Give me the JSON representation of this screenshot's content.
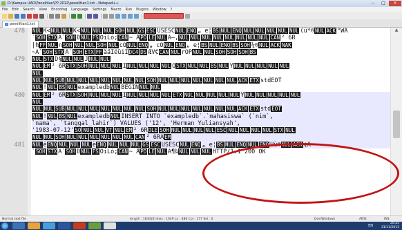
{
  "window": {
    "title": "D:\\Kampus UAD\\Penelitian\\PP 2012\\penelitian1.txt - Notepad++",
    "minimize": "‒",
    "maximize": "□",
    "close": "✕"
  },
  "menu": [
    "File",
    "Edit",
    "Search",
    "View",
    "Encoding",
    "Language",
    "Settings",
    "Macro",
    "Run",
    "Plugins",
    "Window",
    "?"
  ],
  "tab": {
    "label": "penelitian1.txt"
  },
  "editor": {
    "lines": [
      {
        "num": "478",
        "segments": [
          {
            "c": "NUL"
          },
          {
            "t": "K<"
          },
          {
            "c": "NUL"
          },
          {
            "c": "NUL"
          },
          {
            "t": "K<"
          },
          {
            "c": "NUL"
          },
          {
            "c": "NUL"
          },
          {
            "c": "NUL"
          },
          {
            "c": "SOH"
          },
          {
            "c": "NUL"
          },
          {
            "c": "GS"
          },
          {
            "c": "ESC"
          },
          {
            "t": "USESC"
          },
          {
            "c": "NUL"
          },
          {
            "c": "ENQ"
          },
          {
            "t": "„ e¦"
          },
          {
            "c": "BS"
          },
          {
            "c": "NUL"
          },
          {
            "c": "ENQ"
          },
          {
            "c": "NUL"
          },
          {
            "c": "NUL"
          },
          {
            "c": "NUL"
          },
          {
            "c": "NUL"
          },
          {
            "c": "NUL"
          },
          {
            "t": "(ü*®"
          },
          {
            "c": "NUL"
          },
          {
            "c": "ACK"
          },
          {
            "t": "°WA"
          }
        ]
      },
      {
        "num": "",
        "segments": [
          {
            "t": "`"
          },
          {
            "c": "SOH"
          },
          {
            "c": "STX"
          },
          {
            "t": "Ã`"
          },
          {
            "c": "SOH"
          },
          {
            "t": "Ð"
          },
          {
            "c": "NUL"
          },
          {
            "c": "FS"
          },
          {
            "t": "ÒiLó;"
          },
          {
            "c": "CAN"
          },
          {
            "t": "~ Å"
          },
          {
            "c": "PD"
          },
          {
            "c": "LE"
          },
          {
            "c": "NUL"
          },
          {
            "t": "A–,"
          },
          {
            "c": "NUL"
          },
          {
            "c": "NUL"
          },
          {
            "c": "NUL"
          },
          {
            "c": "NUL"
          },
          {
            "c": "NUL"
          },
          {
            "c": "NUL"
          },
          {
            "c": "NUL"
          },
          {
            "c": "NUL"
          },
          {
            "c": "CAN"
          },
          {
            "t": "² 6R"
          }
        ]
      },
      {
        "num": "",
        "segments": [
          {
            "t": "|h"
          },
          {
            "c": "FF"
          },
          {
            "c": "NUL"
          },
          {
            "t": "n"
          },
          {
            "c": "SOH"
          },
          {
            "c": "NUL"
          },
          {
            "c": "NUL"
          },
          {
            "c": "SOH"
          },
          {
            "c": "NUL"
          },
          {
            "t": "cÖ"
          },
          {
            "c": "NUL"
          },
          {
            "c": "ENQ"
          },
          {
            "t": "„ cÖ"
          },
          {
            "c": "NUL"
          },
          {
            "c": "ENQ"
          },
          {
            "t": "„ e¦"
          },
          {
            "c": "BS"
          },
          {
            "c": "NUL"
          },
          {
            "c": "ENQ"
          },
          {
            "c": "BS"
          },
          {
            "c": "SOH"
          },
          {
            "t": "¼®"
          },
          {
            "c": "NUL"
          },
          {
            "c": "ACK"
          },
          {
            "c": "NAK"
          }
        ]
      },
      {
        "num": "",
        "segments": [
          {
            "t": "~A`"
          },
          {
            "c": "SOH"
          },
          {
            "c": "STX"
          },
          {
            "t": "Ã`"
          },
          {
            "c": "SOH"
          },
          {
            "c": "ETX"
          },
          {
            "c": "FF"
          },
          {
            "t": "åäIéüiI"
          },
          {
            "c": "DC4"
          },
          {
            "c": "DS"
          },
          {
            "t": "ÆV€"
          },
          {
            "c": "CAN"
          },
          {
            "c": "NUL"
          },
          {
            "t": "rÓP"
          },
          {
            "c": "NUL"
          },
          {
            "c": "NUL"
          },
          {
            "c": "SOH"
          },
          {
            "c": "SOH"
          },
          {
            "c": "SOH"
          },
          {
            "c": "BS"
          }
        ]
      },
      {
        "num": "479",
        "segments": [
          {
            "c": "NUL"
          },
          {
            "c": "STX"
          },
          {
            "t": "D§"
          },
          {
            "c": "NUL"
          },
          {
            "c": "NUL"
          },
          {
            "t": "J"
          },
          {
            "c": "NUL"
          },
          {
            "c": "NUL"
          }
        ]
      },
      {
        "num": "",
        "segments": [
          {
            "c": "NUL"
          },
          {
            "c": "EM"
          },
          {
            "t": "² 6R"
          },
          {
            "c": "STX"
          },
          {
            "c": "SOH"
          },
          {
            "c": "NUL"
          },
          {
            "c": "NUL"
          },
          {
            "c": "NUL"
          },
          {
            "t": "I"
          },
          {
            "c": "NUL"
          },
          {
            "c": "NUL"
          },
          {
            "c": "NUL"
          },
          {
            "c": "NUL"
          },
          {
            "t": "Ò"
          },
          {
            "c": "STX"
          },
          {
            "c": "NUL"
          },
          {
            "c": "NUL"
          },
          {
            "c": "BS"
          },
          {
            "c": "NUL"
          },
          {
            "t": "Y"
          },
          {
            "c": "NUL"
          },
          {
            "c": "NUL"
          },
          {
            "c": "NUL"
          },
          {
            "c": "NUL"
          },
          {
            "c": "NUL"
          }
        ]
      },
      {
        "num": "",
        "segments": [
          {
            "c": "NUL"
          }
        ]
      },
      {
        "num": "",
        "segments": [
          {
            "c": "NUL"
          },
          {
            "c": "NUL"
          },
          {
            "c": "SUB"
          },
          {
            "c": "NUL"
          },
          {
            "c": "NUL"
          },
          {
            "c": "NUL"
          },
          {
            "c": "NUL"
          },
          {
            "c": "NUL"
          },
          {
            "c": "NUL"
          },
          {
            "c": "NUL"
          },
          {
            "c": "SOH"
          },
          {
            "c": "NUL"
          },
          {
            "c": "NUL"
          },
          {
            "c": "NUL"
          },
          {
            "c": "NUL"
          },
          {
            "c": "NUL"
          },
          {
            "c": "NUL"
          },
          {
            "c": "NUL"
          },
          {
            "c": "ACK"
          },
          {
            "c": "ETX"
          },
          {
            "t": "stdEOT"
          }
        ]
      },
      {
        "num": "",
        "segments": [
          {
            "c": "NUL"
          },
          {
            "t": "!"
          },
          {
            "c": "NUL"
          },
          {
            "c": "BS"
          },
          {
            "c": "NUL"
          },
          {
            "t": "exampledb"
          },
          {
            "c": "NUL"
          },
          {
            "t": "BEGIN"
          },
          {
            "c": "NUL"
          },
          {
            "c": "NUL"
          }
        ]
      },
      {
        "num": "480",
        "segments": [
          {
            "c": "NUL"
          },
          {
            "c": "EM"
          },
          {
            "t": "² 6R"
          },
          {
            "c": "STX"
          },
          {
            "c": "SOH"
          },
          {
            "c": "NUL"
          },
          {
            "c": "NUL"
          },
          {
            "c": "NUL"
          },
          {
            "t": "I"
          },
          {
            "c": "NUL"
          },
          {
            "c": "NUL"
          },
          {
            "c": "NUL"
          },
          {
            "c": "NUL"
          },
          {
            "c": "ETX"
          },
          {
            "c": "NUL"
          },
          {
            "c": "NUL"
          },
          {
            "c": "NUL"
          },
          {
            "c": "NUL"
          },
          {
            "c": "NUL"
          },
          {
            "t": "Y"
          },
          {
            "c": "NUL"
          },
          {
            "c": "NUL"
          },
          {
            "c": "NUL"
          },
          {
            "c": "NUL"
          },
          {
            "c": "NUL"
          }
        ]
      },
      {
        "num": "",
        "segments": [
          {
            "c": "NUL"
          }
        ]
      },
      {
        "num": "",
        "segments": [
          {
            "c": "NUL"
          },
          {
            "c": "NUL"
          },
          {
            "c": "SUB"
          },
          {
            "c": "NUL"
          },
          {
            "c": "NUL"
          },
          {
            "c": "NUL"
          },
          {
            "c": "NUL"
          },
          {
            "c": "NUL"
          },
          {
            "c": "NUL"
          },
          {
            "c": "NUL"
          },
          {
            "c": "SOH"
          },
          {
            "c": "NUL"
          },
          {
            "c": "NUL"
          },
          {
            "c": "NUL"
          },
          {
            "c": "NUL"
          },
          {
            "c": "NUL"
          },
          {
            "c": "NUL"
          },
          {
            "c": "NUL"
          },
          {
            "c": "ACK"
          },
          {
            "c": "ETX"
          },
          {
            "t": "std"
          },
          {
            "c": "EOT"
          }
        ]
      },
      {
        "num": "",
        "segments": [
          {
            "c": "NUL"
          },
          {
            "t": "!"
          },
          {
            "c": "NUL"
          },
          {
            "c": "BS"
          },
          {
            "c": "NUL"
          },
          {
            "t": "exampledb"
          },
          {
            "c": "NUL"
          },
          {
            "t": "INSERT INTO `exampledb`.`mahasiswa` (`nim`,"
          }
        ]
      },
      {
        "num": "",
        "segments": [
          {
            "t": "`nama`, `tanggal_lahir`) VALUES ('12', 'Herman Yuliansyah',"
          }
        ]
      },
      {
        "num": "",
        "segments": [
          {
            "t": "'1983-07-12'"
          },
          {
            "c": "SO"
          },
          {
            "c": "NUL"
          },
          {
            "c": "NUL"
          },
          {
            "c": "VT"
          },
          {
            "c": "NUL"
          },
          {
            "c": "EM"
          },
          {
            "t": "² 6R"
          },
          {
            "c": "DLE"
          },
          {
            "c": "SOH"
          },
          {
            "c": "NUL"
          },
          {
            "c": "NUL"
          },
          {
            "c": "NUL"
          },
          {
            "c": "NUL"
          },
          {
            "c": "ESC"
          },
          {
            "c": "NUL"
          },
          {
            "c": "NUL"
          },
          {
            "c": "NUL"
          },
          {
            "c": "NUL"
          },
          {
            "c": "STX"
          },
          {
            "c": "NUL"
          }
        ]
      },
      {
        "num": "",
        "segments": [
          {
            "c": "NUL"
          },
          {
            "c": "NUL"
          },
          {
            "c": "SOH"
          },
          {
            "c": "NUL"
          },
          {
            "c": "NUL"
          },
          {
            "c": "NUL"
          },
          {
            "c": "NUL"
          },
          {
            "c": "NUL"
          },
          {
            "c": "NUL"
          },
          {
            "c": "CAN"
          },
          {
            "t": "² 6RA"
          },
          {
            "c": "EM"
          }
        ]
      },
      {
        "num": "481",
        "segments": [
          {
            "c": "NUL"
          },
          {
            "t": "ë"
          },
          {
            "c": "ENQ"
          },
          {
            "c": "NUL"
          },
          {
            "c": "NUL"
          },
          {
            "c": "NUL"
          },
          {
            "t": "ë"
          },
          {
            "c": "ENQ"
          },
          {
            "c": "NUL"
          },
          {
            "c": "NUL"
          },
          {
            "c": "NUL"
          },
          {
            "c": "GS"
          },
          {
            "c": "ESC"
          },
          {
            "t": "USESC"
          },
          {
            "c": "NUL"
          },
          {
            "c": "ENQ"
          },
          {
            "t": "„ e¦"
          },
          {
            "c": "BS"
          },
          {
            "c": "NUL"
          },
          {
            "c": "ENQ"
          },
          {
            "c": "NUL"
          },
          {
            "c": "ENQ"
          },
          {
            "t": "Üü®"
          },
          {
            "c": "NUL"
          },
          {
            "c": "ACK"
          },
          {
            "t": "¢Å"
          }
        ]
      },
      {
        "num": "",
        "segments": [
          {
            "t": "`"
          },
          {
            "c": "SOH"
          },
          {
            "c": "STX"
          },
          {
            "t": "Ã`"
          },
          {
            "c": "SOH"
          },
          {
            "t": "Ð"
          },
          {
            "c": "NUL"
          },
          {
            "c": "FS"
          },
          {
            "t": "ÒiLó;"
          },
          {
            "c": "CAN"
          },
          {
            "t": "~ Å"
          },
          {
            "c": "PD"
          },
          {
            "c": "LE"
          },
          {
            "c": "NUL"
          },
          {
            "t": "A¶‰"
          },
          {
            "c": "NUL"
          },
          {
            "c": "NUL"
          },
          {
            "c": "NUL"
          },
          {
            "t": "HTTP/1.1 200 OK"
          }
        ]
      }
    ]
  },
  "statusbar": {
    "file_type": "Normal text file",
    "position": "length : 183424    lines : 1049        Ln : 480    Col : 177    Sel : 0",
    "eol": "Dos\\Windows",
    "encoding": "ANSI",
    "mode": "INS"
  },
  "taskbar": {
    "lang": "EN",
    "time": "20:25",
    "date": "21/11/2013"
  },
  "colors": {
    "control_char_bg": "#1a1a1a",
    "annotation": "#c41414",
    "taskbar": "#1e3d6e"
  }
}
